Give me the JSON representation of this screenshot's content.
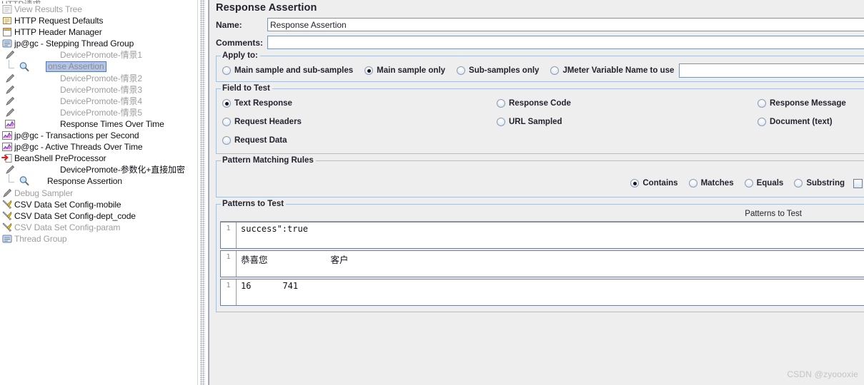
{
  "tree": {
    "clipped_top_item": "HTTP请求",
    "items": [
      {
        "label": "View Results Tree",
        "icon": "results-tree-icon",
        "state": "disabled",
        "indent": 0,
        "selected": false
      },
      {
        "label": "HTTP Request Defaults",
        "icon": "config-defaults-icon",
        "state": "enabled",
        "indent": 0,
        "selected": false
      },
      {
        "label": "HTTP Header Manager",
        "icon": "header-manager-icon",
        "state": "enabled",
        "indent": 0,
        "selected": false
      },
      {
        "label": "jp@gc - Stepping Thread Group",
        "icon": "thread-group-icon",
        "state": "enabled",
        "indent": 0,
        "selected": false
      },
      {
        "label": "DevicePromote-情景1",
        "icon": "sampler-icon",
        "state": "disabled",
        "indent": 1,
        "selected": false
      },
      {
        "label": "onse Assertion",
        "icon": "assertion-icon",
        "state": "disabled",
        "indent": 1,
        "selected": true
      },
      {
        "label": "DevicePromote-情景2",
        "icon": "sampler-icon",
        "state": "disabled",
        "indent": 1,
        "selected": false
      },
      {
        "label": "DevicePromote-情景3",
        "icon": "sampler-icon",
        "state": "disabled",
        "indent": 1,
        "selected": false
      },
      {
        "label": "DevicePromote-情景4",
        "icon": "sampler-icon",
        "state": "disabled",
        "indent": 1,
        "selected": false
      },
      {
        "label": "DevicePromote-情景5",
        "icon": "sampler-icon",
        "state": "disabled",
        "indent": 1,
        "selected": false
      },
      {
        "label": "Response Times Over Time",
        "icon": "graph-icon",
        "state": "enabled",
        "indent": 1,
        "selected": false
      },
      {
        "label": "jp@gc - Transactions per Second",
        "icon": "graph-icon",
        "state": "enabled",
        "indent": 0,
        "selected": false
      },
      {
        "label": "jp@gc - Active Threads Over Time",
        "icon": "graph-icon",
        "state": "enabled",
        "indent": 0,
        "selected": false
      },
      {
        "label": "BeanShell PreProcessor",
        "icon": "preprocessor-icon",
        "state": "enabled",
        "indent": 0,
        "selected": false
      },
      {
        "label": "DevicePromote-参数化+直接加密",
        "icon": "sampler-icon",
        "state": "enabled",
        "indent": 1,
        "selected": false
      },
      {
        "label": "Response Assertion",
        "icon": "assertion-icon",
        "state": "enabled",
        "indent": 1,
        "selected": false
      },
      {
        "label": "Debug Sampler",
        "icon": "sampler-icon",
        "state": "disabled",
        "indent": 0,
        "selected": false
      },
      {
        "label": "CSV Data Set Config-mobile",
        "icon": "csv-config-icon",
        "state": "enabled",
        "indent": 0,
        "selected": false
      },
      {
        "label": "CSV Data Set Config-dept_code",
        "icon": "csv-config-icon",
        "state": "enabled",
        "indent": 0,
        "selected": false
      },
      {
        "label": "CSV Data Set Config-param",
        "icon": "csv-config-icon",
        "state": "disabled",
        "indent": 0,
        "selected": false
      },
      {
        "label": "Thread Group",
        "icon": "thread-group-icon",
        "state": "disabled",
        "indent": 0,
        "selected": false
      }
    ]
  },
  "panel": {
    "title": "Response Assertion",
    "name_label": "Name:",
    "name_value": "Response Assertion",
    "comments_label": "Comments:",
    "comments_value": "",
    "apply_to": {
      "title": "Apply to:",
      "options": [
        {
          "label": "Main sample and sub-samples",
          "selected": false
        },
        {
          "label": "Main sample only",
          "selected": true
        },
        {
          "label": "Sub-samples only",
          "selected": false
        },
        {
          "label": "JMeter Variable Name to use",
          "selected": false
        }
      ],
      "variable_value": ""
    },
    "field_to_test": {
      "title": "Field to Test",
      "options": [
        {
          "label": "Text Response",
          "selected": true
        },
        {
          "label": "Response Code",
          "selected": false
        },
        {
          "label": "Response Message",
          "selected": false
        },
        {
          "label": "Request Headers",
          "selected": false
        },
        {
          "label": "URL Sampled",
          "selected": false
        },
        {
          "label": "Document (text)",
          "selected": false
        },
        {
          "label": "Request Data",
          "selected": false
        }
      ]
    },
    "pattern_matching_rules": {
      "title": "Pattern Matching Rules",
      "options": [
        {
          "label": "Contains",
          "selected": true
        },
        {
          "label": "Matches",
          "selected": false
        },
        {
          "label": "Equals",
          "selected": false
        },
        {
          "label": "Substring",
          "selected": false
        }
      ],
      "not_checkbox_checked": false
    },
    "patterns_to_test": {
      "title": "Patterns to Test",
      "column_header": "Patterns to Test",
      "rows": [
        {
          "line_no": "1",
          "text": "success\":true",
          "cjk": false
        },
        {
          "line_no": "1",
          "text": "恭喜您",
          "text2": "客户",
          "cjk": true
        },
        {
          "line_no": "1",
          "text": "16",
          "text2": "741",
          "cjk": false
        }
      ]
    }
  },
  "watermark": "CSDN @zyoooxie",
  "colors": {
    "panel_bg": "#eeeeee",
    "selection": "#b4c4e3",
    "group_border": "#a8c0dc",
    "disabled_text": "#9d9d9d"
  }
}
